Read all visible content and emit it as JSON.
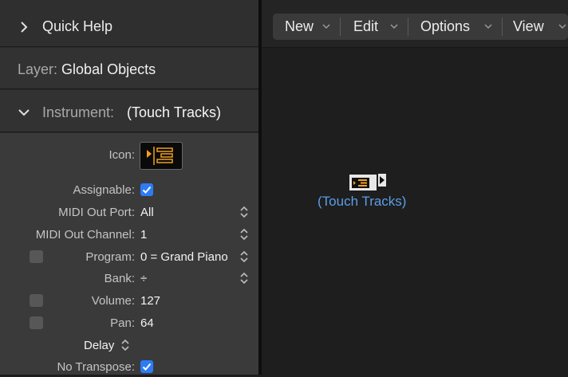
{
  "inspector": {
    "quick_help": "Quick Help",
    "layer_label": "Layer:",
    "layer_value": "Global Objects",
    "instrument_label": "Instrument:",
    "instrument_value": "(Touch Tracks)",
    "properties": {
      "icon_label": "Icon:",
      "assignable_label": "Assignable:",
      "midi_out_port_label": "MIDI Out Port:",
      "midi_out_port_value": "All",
      "midi_out_channel_label": "MIDI Out Channel:",
      "midi_out_channel_value": "1",
      "program_label": "Program:",
      "program_value": "0 = Grand Piano",
      "bank_label": "Bank:",
      "bank_value": "÷",
      "volume_label": "Volume:",
      "volume_value": "127",
      "pan_label": "Pan:",
      "pan_value": "64",
      "delay_label": "Delay",
      "no_transpose_label": "No Transpose:"
    }
  },
  "menubar": {
    "new": "New",
    "edit": "Edit",
    "options": "Options",
    "view": "View"
  },
  "environment": {
    "object_name": "(Touch Tracks)"
  },
  "colors": {
    "accent_blue": "#2d7cf6",
    "link_blue": "#5c9de8",
    "icon_orange": "#f0a020"
  }
}
